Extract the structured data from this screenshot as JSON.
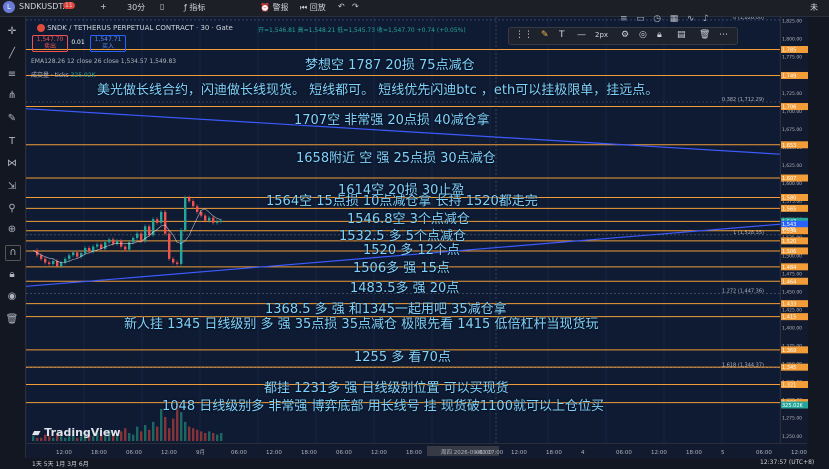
{
  "header": {
    "tab_title": "SNDKUSDT.P",
    "tab_badge": "11",
    "interval": "30分",
    "indicators_label": "指标",
    "alert_label": "警报",
    "replay_label": "回放",
    "symbol_full": "SNDK / TETHERUS PERPETUAL CONTRACT · 30 · Gate",
    "ohlc": "开=1,546.81  高=1,548.21  低=1,545.73  收=1,547.70  +0.74 (+0.05%)",
    "sell_price": "1,547.70",
    "sell_label": "卖出",
    "spread": "0.01",
    "buy_price": "1,547.71",
    "buy_label": "买入",
    "ema_legend": "EMA128.26 12 close 26 close 1,534.57 1,549.83",
    "volume_legend": "成交量 · ticks",
    "volume_value": "325.02K",
    "right_corner": "未"
  },
  "drawing_toolbar": {
    "width_label": "2px"
  },
  "annotations": [
    "梦想空    1787    20损    75点减仓",
    "美光做长线合约，闪迪做长线现货。 短线都可。 短线优先闪迪btc ，eth可以挂极限单，挂远点。",
    "1707空 非常强      20点损     40减仓拿",
    "1658附近 空 强    25点损  30点减仓",
    "1614空    20损  30止盈",
    "1564空  15点损 10点减仓拿  长持 1520都走完",
    "1546.8空  3个点减仓",
    "1532.5  多   5个点减仓",
    "1520 多    12个点",
    "1506多   强       15点",
    "1483.5多  强       20点",
    "1368.5  多 强     和1345一起用吧     35减仓拿",
    "新人挂 1345    日线级别 多 强   35点损     35点减仓      极限先看 1415   低倍杠杆当现货玩",
    "1255 多       看70点",
    "都挂   1231多 强  日线级别位置      可以买现货",
    "1048 日线级别多 非常强 博弈底部   用长线号 挂    现货破1100就可以上仓位买"
  ],
  "price_axis": {
    "ticks": [
      "1,825.00",
      "1,800.00",
      "1,775.00",
      "1,750.00",
      "1,725.00",
      "1,700.00",
      "1,675.00",
      "1,650.00",
      "1,625.00",
      "1,600.00",
      "1,575.00",
      "1,550.00",
      "1,525.00",
      "1,500.00",
      "1,475.00",
      "1,450.00",
      "1,425.00",
      "1,400.00",
      "1,375.00",
      "1,350.00",
      "1,325.00",
      "1,300.00",
      "1,275.00",
      "1,250.00"
    ],
    "labels": [
      "1,785",
      "1,749",
      "1,706",
      "1,653",
      "1,607",
      "1,580",
      "1,565",
      "1,547",
      "1,543",
      "1,534",
      "1,520",
      "1,506",
      "1,484",
      "1,464",
      "1,433",
      "1,415",
      "1,369",
      "1,345",
      "1,321",
      "1,296",
      "325.02K"
    ]
  },
  "fib_labels": [
    "0 (1,826.00)",
    "0.382 (1,712.29)",
    "1 (1,528.35)",
    "1.272 (1,447.36)",
    "1.618 (1,344.37)"
  ],
  "time_axis": {
    "ticks": [
      "12:00",
      "18:00",
      "06:00",
      "12:00",
      "9月",
      "06:00",
      "12:00",
      "18:00",
      "06:00",
      "12:00",
      "18:00",
      "周四 2026-09-03  17:00",
      "06:00",
      "12:00",
      "18:00",
      "4",
      "06:00",
      "12:00",
      "18:00",
      "5",
      "06:00",
      "12:00"
    ],
    "countdown": "06:08"
  },
  "branding": {
    "watermark": "TradingView"
  },
  "bottom": {
    "ranges": "1天  5天  1月  3月  6月",
    "clock": "12:37:57 (UTC+8)"
  },
  "chart_data": {
    "type": "line",
    "title": "SNDK / TETHERUS PERPETUAL CONTRACT · 30 · Gate",
    "ylim": [
      1240,
      1830
    ],
    "price": [
      1507,
      1500,
      1495,
      1490,
      1488,
      1492,
      1485,
      1490,
      1495,
      1500,
      1504,
      1498,
      1503,
      1510,
      1505,
      1512,
      1515,
      1509,
      1518,
      1522,
      1516,
      1520,
      1512,
      1508,
      1518,
      1524,
      1530,
      1520,
      1540,
      1528,
      1550,
      1545,
      1560,
      1530,
      1495,
      1490,
      1488,
      1535,
      1580,
      1575,
      1568,
      1560,
      1555,
      1548,
      1552,
      1545,
      1547,
      1548
    ],
    "level_lines": [
      1785,
      1749,
      1706,
      1653,
      1607,
      1580,
      1565,
      1547,
      1534,
      1520,
      1506,
      1484,
      1464,
      1433,
      1415,
      1369,
      1345,
      1321,
      1296
    ],
    "fib_levels": [
      {
        "ratio": 0,
        "price": 1826.0
      },
      {
        "ratio": 0.382,
        "price": 1712.29
      },
      {
        "ratio": 1,
        "price": 1528.35
      },
      {
        "ratio": 1.272,
        "price": 1447.36
      },
      {
        "ratio": 1.618,
        "price": 1344.37
      }
    ],
    "volume": [
      3,
      2,
      2,
      4,
      3,
      2,
      5,
      3,
      2,
      3,
      4,
      2,
      3,
      6,
      4,
      3,
      5,
      4,
      3,
      7,
      5,
      4,
      6,
      8,
      5,
      4,
      9,
      6,
      10,
      7,
      12,
      9,
      20,
      15,
      8,
      14,
      25,
      18,
      12,
      9,
      8,
      7,
      6,
      5,
      6,
      5,
      4,
      5
    ],
    "last_price": 1547.7,
    "last_volume": "325.02K"
  },
  "colors": {
    "background": "#0e1b33",
    "level_line": "#f29d38",
    "annotation_text": "#7fd3ff",
    "trendline": "#3d5afe",
    "candle_up": "#26a69a",
    "candle_down": "#ef5350"
  }
}
